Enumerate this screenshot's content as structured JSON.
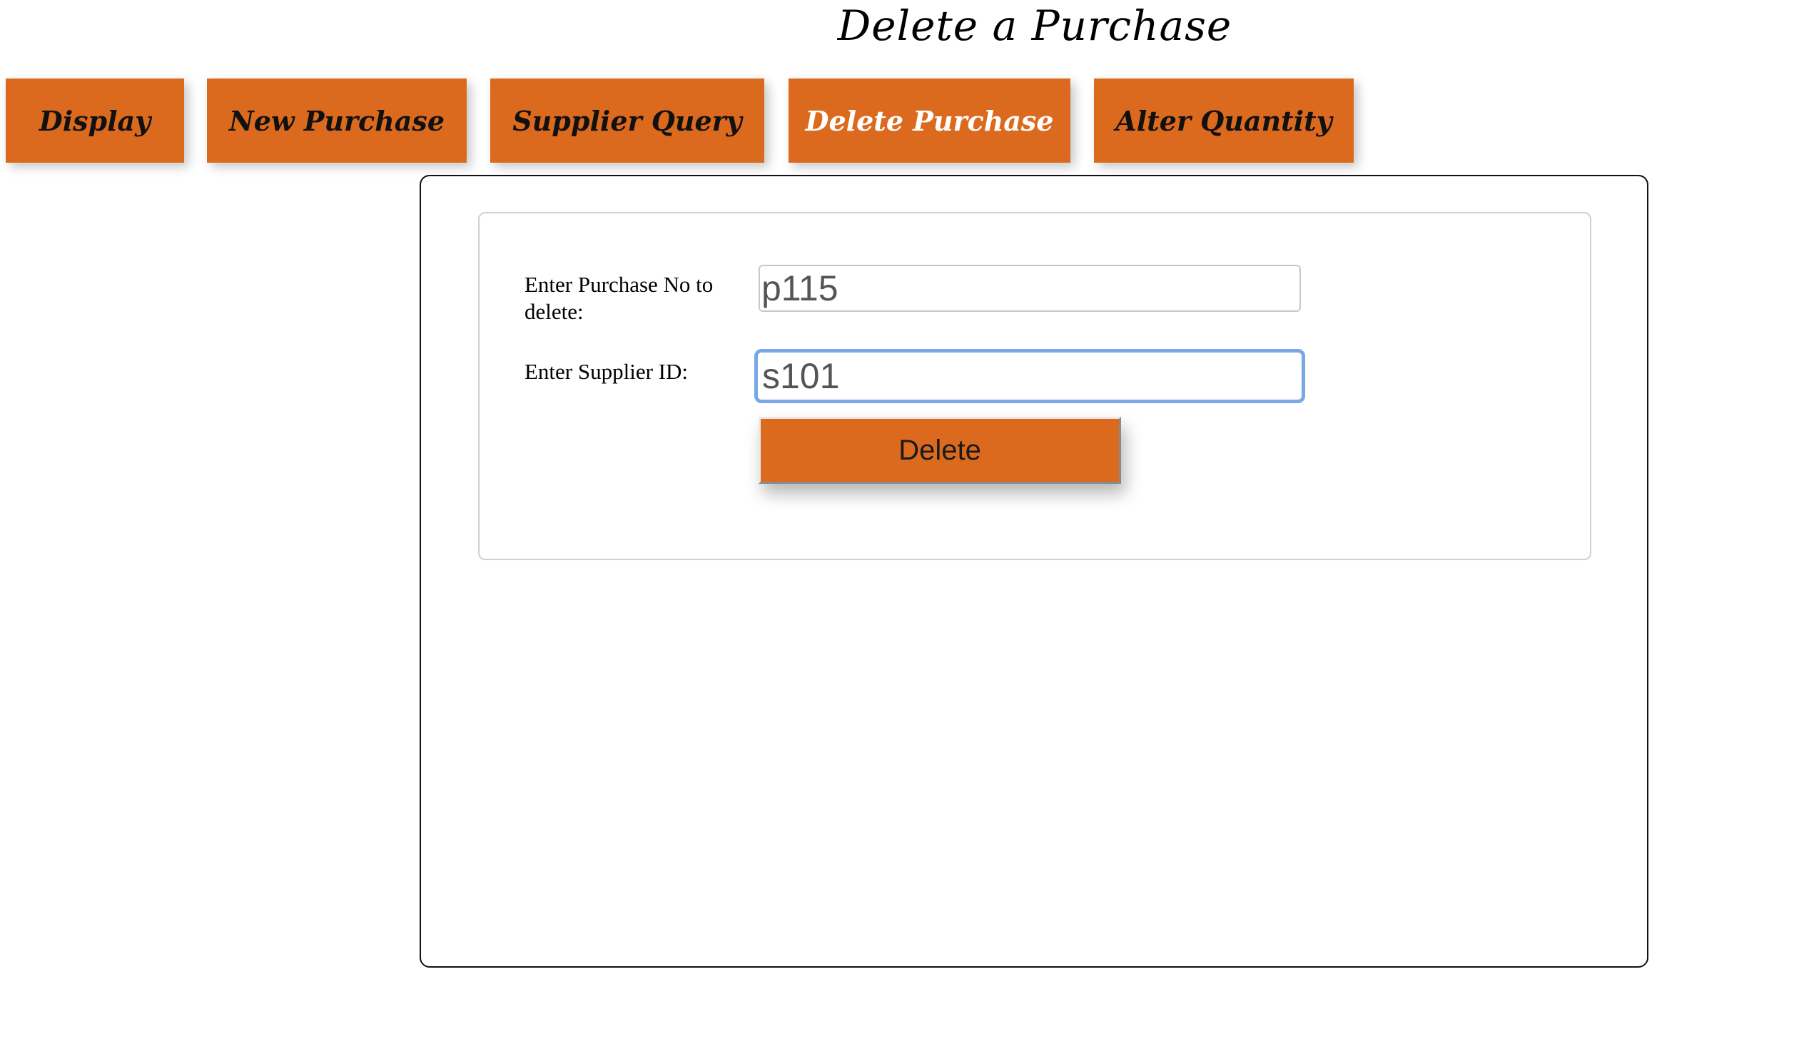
{
  "page": {
    "title": "Delete a Purchase"
  },
  "nav": {
    "items": [
      {
        "label": "Display",
        "active": false
      },
      {
        "label": "New Purchase",
        "active": false
      },
      {
        "label": "Supplier Query",
        "active": false
      },
      {
        "label": "Delete Purchase",
        "active": true
      },
      {
        "label": "Alter Quantity",
        "active": false
      }
    ]
  },
  "form": {
    "purchase_label": "Enter Purchase No to delete:",
    "purchase_value": "p115",
    "supplier_label": "Enter Supplier ID:",
    "supplier_value": "s101",
    "delete_label": "Delete"
  },
  "colors": {
    "accent": "#db6a1e",
    "focus_ring": "#78a9e6",
    "active_nav_text": "#ffffff"
  }
}
